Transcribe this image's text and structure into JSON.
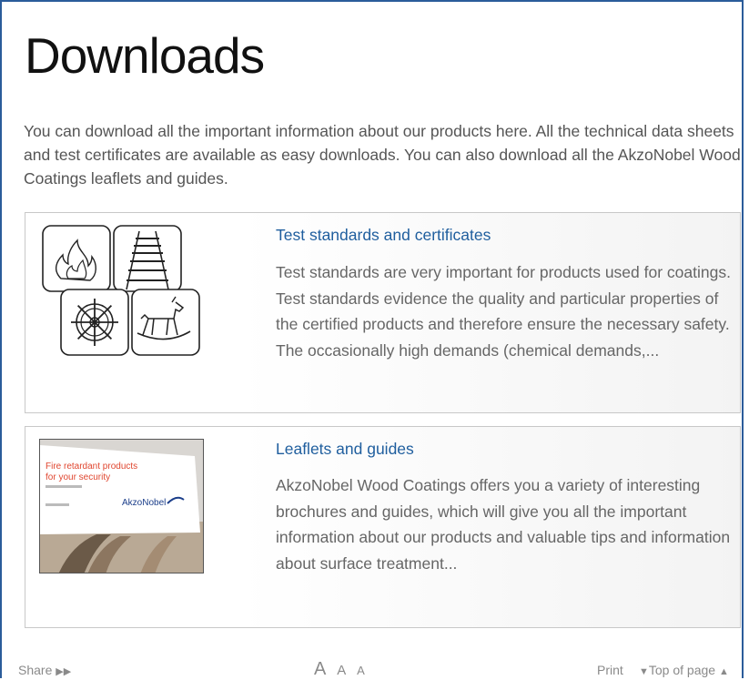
{
  "page": {
    "title": "Downloads",
    "intro": "You can download all the important information about our products here. All the technical data sheets and test certificates are available as easy downloads. You can also download all the AkzoNobel Wood Coatings leaflets and guides."
  },
  "cards": [
    {
      "title": "Test standards and certificates",
      "text": "Test standards are very important for products used for coatings. Test standards evidence the quality and particular properties of the certified products and therefore ensure the necessary safety. The occasionally high demands (chemical demands,...",
      "icons": [
        "fire-icon",
        "railway-track-icon",
        "ship-wheel-icon",
        "rocking-horse-icon"
      ]
    },
    {
      "title": "Leaflets and guides",
      "text": "AkzoNobel Wood Coatings offers you a variety of interesting brochures and guides, which will give you all the important information about our products and valuable tips and information about surface treatment...",
      "brochure": {
        "heading_line1": "Fire retardant products",
        "heading_line2": "for your security",
        "brand": "AkzoNobel"
      }
    }
  ],
  "footer": {
    "share": "Share",
    "share_arrow": "▶▶",
    "font_large": "A",
    "font_medium": "A",
    "font_small": "A",
    "print": "Print",
    "print_arrow": "▼",
    "top_of_page": "Top of page",
    "top_arrow": "▲"
  },
  "colors": {
    "border_accent": "#2b5c9a",
    "link": "#1f5e9e",
    "text": "#555555"
  }
}
